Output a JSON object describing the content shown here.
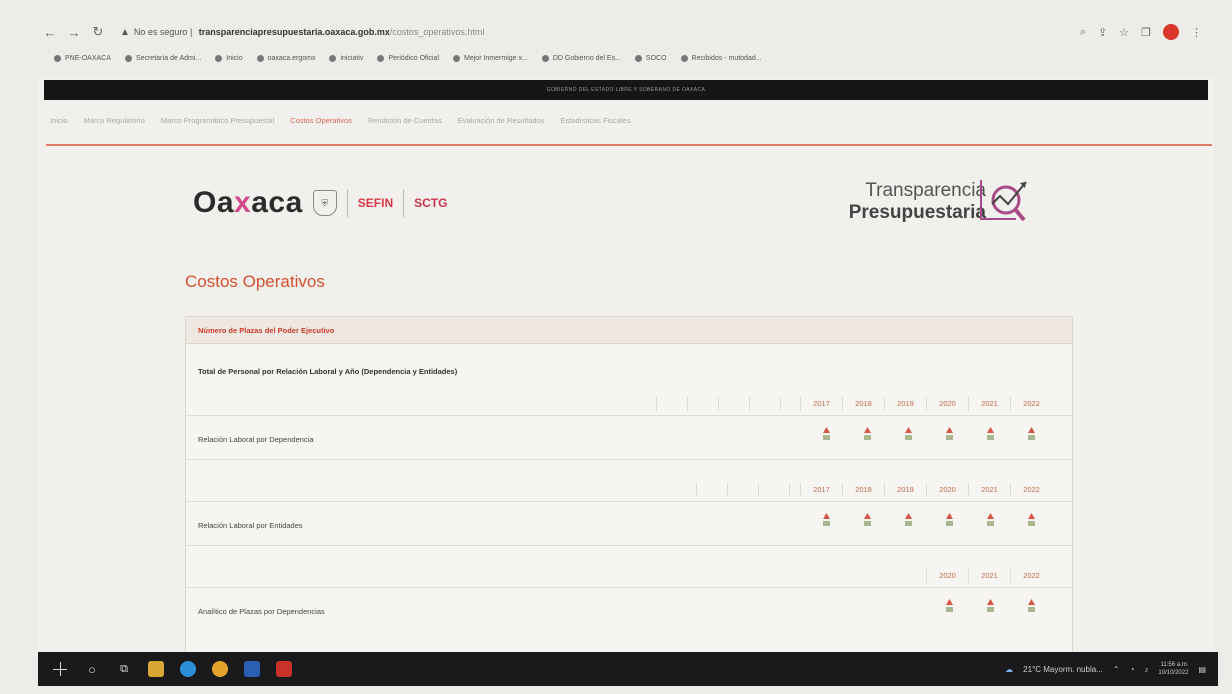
{
  "browser": {
    "security_label": "No es seguro",
    "url_domain": "transparenciapresupuestaria.oaxaca.gob.mx",
    "url_path": "/costos_operativos.html",
    "bookmarks": [
      "PNE-OAXACA",
      "Secretaría de Admi...",
      "Inicio",
      "oaxaca.ergomx",
      "iniciativ",
      "Periódico Oficial",
      "Mejor Inmermige x...",
      "DD Gobierno del Es...",
      "SOCO",
      "Recibidos - mutodad..."
    ]
  },
  "site": {
    "gov_banner": "GOBIERNO DEL ESTADO LIBRE Y SOBERANO DE OAXACA",
    "nav": [
      "Inicio",
      "Marco Regulatorio",
      "Marco Programático Presupuestal",
      "Costos Operativos",
      "Rendición de Cuentas",
      "Evaluación de Resultados",
      "Estadísticas Fiscales"
    ],
    "active_nav": "Costos Operativos",
    "logos": {
      "oaxaca_pre": "Oa",
      "oaxaca_x": "x",
      "oaxaca_post": "aca",
      "sefin": "SEFIN",
      "sctg": "SCTG",
      "transparencia": "Transparencia",
      "presupuestaria": "Presupuestaria"
    },
    "page_title": "Costos Operativos",
    "panel": {
      "heading": "Número de Plazas del Poder Ejecutivo",
      "subtitle": "Total de Personal por Relación Laboral y Año (Dependencia y Entidades)",
      "rows": [
        {
          "label": "Relación Laboral por Dependencia",
          "years": [
            "2017",
            "2018",
            "2019",
            "2020",
            "2021",
            "2022"
          ]
        },
        {
          "label": "Relación Laboral por Entidades",
          "years": [
            "2017",
            "2018",
            "2019",
            "2020",
            "2021",
            "2022"
          ]
        },
        {
          "label": "Analítico de Plazas por Dependencias",
          "years": [
            "2020",
            "2021",
            "2022"
          ]
        }
      ]
    }
  },
  "taskbar": {
    "weather": "21°C Mayorm. nubla...",
    "time": "11:56 a.m.",
    "date": "10/10/2022"
  }
}
